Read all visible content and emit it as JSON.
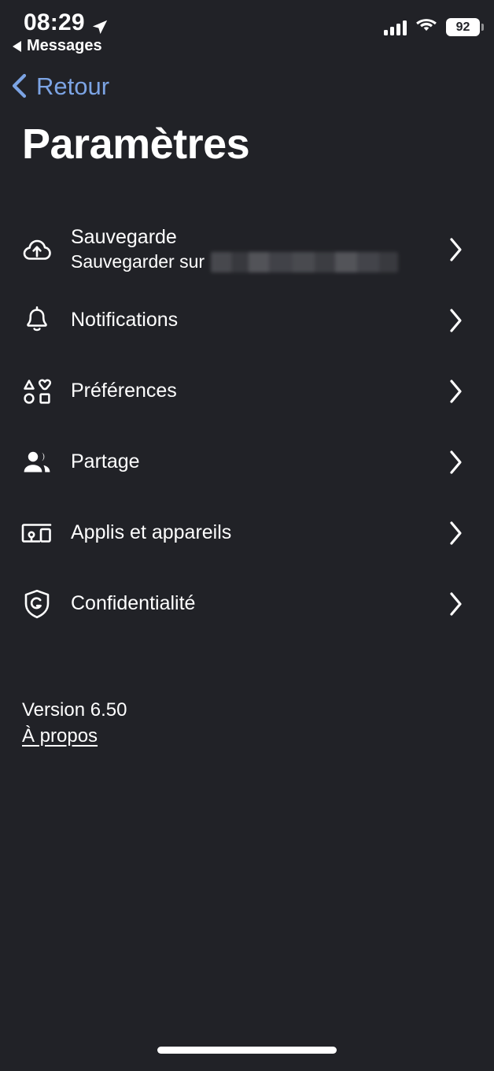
{
  "theme": {
    "background": "#212227",
    "text": "#FFFFFF",
    "accent_blue": "#7CA4E4",
    "redaction": "#4A4B50"
  },
  "status_bar": {
    "time": "08:29",
    "location_icon": "location-arrow-icon",
    "back_to_app": "Messages",
    "back_to_app_icon": "triangle-left-icon",
    "cellular_icon": "cellular-bars-icon",
    "wifi_icon": "wifi-icon",
    "battery_level": "92",
    "battery_icon": "battery-icon"
  },
  "nav": {
    "back_label": "Retour",
    "back_icon": "chevron-left-icon"
  },
  "header": {
    "title": "Paramètres"
  },
  "settings": {
    "items": [
      {
        "label": "Sauvegarde",
        "subtitle_prefix": "Sauvegarder sur",
        "subtitle_redacted": true,
        "icon": "cloud-upload-icon",
        "chevron": "chevron-right-icon"
      },
      {
        "label": "Notifications",
        "icon": "bell-icon",
        "chevron": "chevron-right-icon"
      },
      {
        "label": "Préférences",
        "icon": "shapes-grid-icon",
        "chevron": "chevron-right-icon"
      },
      {
        "label": "Partage",
        "icon": "people-group-icon",
        "chevron": "chevron-right-icon"
      },
      {
        "label": "Applis et appareils",
        "icon": "devices-icon",
        "chevron": "chevron-right-icon"
      },
      {
        "label": "Confidentialité",
        "icon": "shield-g-icon",
        "chevron": "chevron-right-icon"
      }
    ]
  },
  "footer": {
    "version": "Version 6.50",
    "about_label": "À propos"
  },
  "home_indicator": "home-indicator-bar"
}
